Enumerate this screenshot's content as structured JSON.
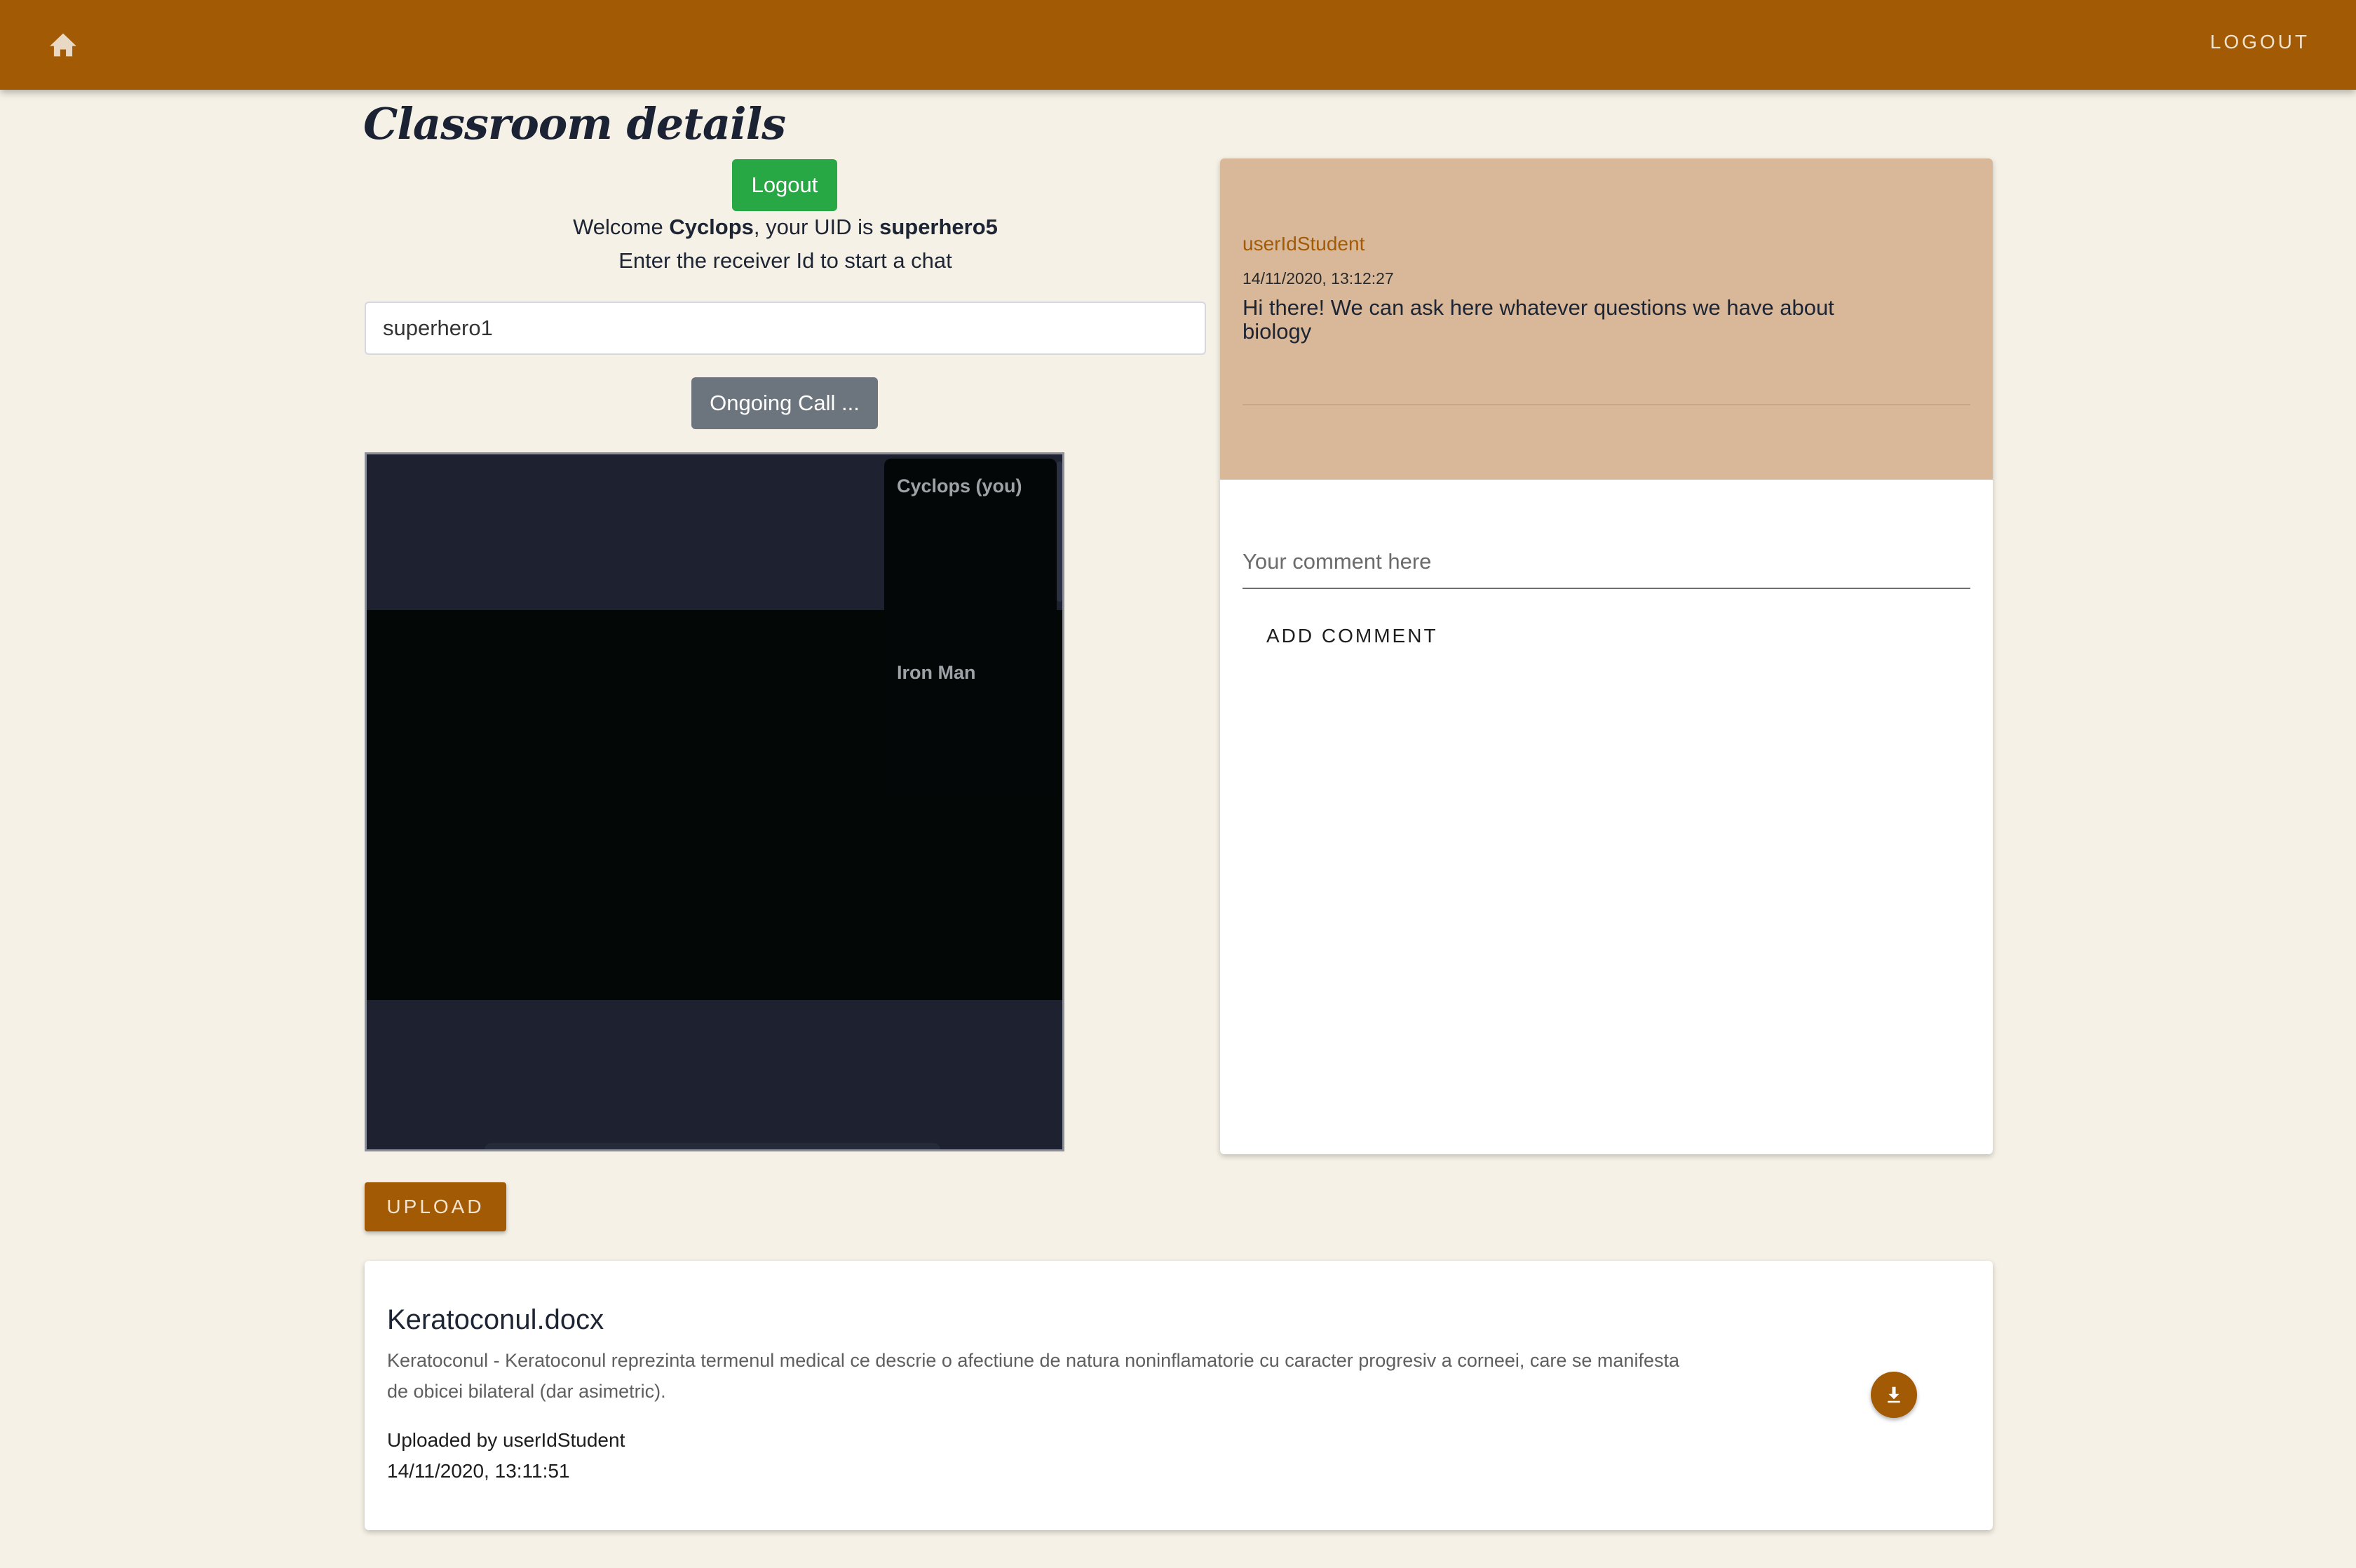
{
  "appbar": {
    "home_icon": "home-icon",
    "logout_label": "LOGOUT",
    "color": "#a35a04"
  },
  "page": {
    "title": "Classroom details"
  },
  "session": {
    "logout_button": "Logout",
    "welcome_prefix": "Welcome ",
    "user_name": "Cyclops",
    "welcome_mid": ", your UID is ",
    "uid": "superhero5",
    "hint": "Enter the receiver Id to start a chat",
    "receiver_value": "superhero1",
    "call_button": "Ongoing Call ..."
  },
  "video": {
    "self_label": "Cyclops (you)",
    "peer_label": "Iron Man"
  },
  "upload": {
    "button_label": "UPLOAD"
  },
  "chat": {
    "messages": [
      {
        "author": "userIdStudent",
        "timestamp": "14/11/2020, 13:12:27",
        "text": "Hi there! We can ask here whatever questions we have about biology"
      }
    ],
    "comment_placeholder": "Your comment here",
    "add_comment_label": "ADD COMMENT"
  },
  "files": [
    {
      "name": "Keratoconul.docx",
      "description": "Keratoconul - Keratoconul reprezinta termenul medical ce descrie o afectiune de natura noninflamatorie cu caracter progresiv a corneei, care se manifesta de obicei bilateral (dar asimetric).",
      "uploaded_by": "Uploaded by userIdStudent",
      "date": "14/11/2020, 13:11:51",
      "download_icon": "download-icon"
    }
  ],
  "colors": {
    "accent": "#a35a04",
    "background": "#f5f1e6",
    "chat_header": "#d8b899",
    "success": "#28a745",
    "secondary": "#6c757d"
  }
}
